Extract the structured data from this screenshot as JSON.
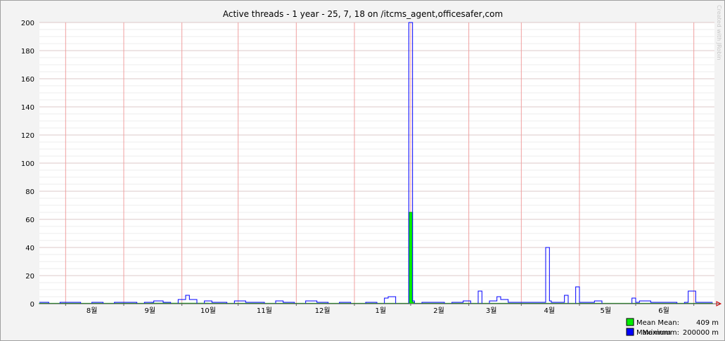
{
  "chart_data": {
    "type": "line",
    "title": "Active threads - 1 year - 25, 7, 18 on /itcms_agent,officesafer,com",
    "watermark": "Created with JRobin",
    "ylim": [
      0,
      200
    ],
    "yticks": [
      "0",
      "20",
      "40",
      "60",
      "80",
      "100",
      "120",
      "140",
      "160",
      "180",
      "200"
    ],
    "xlim": [
      0,
      360
    ],
    "month_labels": [
      {
        "label": "8월",
        "pos": 28
      },
      {
        "label": "9월",
        "pos": 59
      },
      {
        "label": "10월",
        "pos": 90
      },
      {
        "label": "11월",
        "pos": 120
      },
      {
        "label": "12월",
        "pos": 151
      },
      {
        "label": "1월",
        "pos": 182
      },
      {
        "label": "2월",
        "pos": 213
      },
      {
        "label": "3월",
        "pos": 241
      },
      {
        "label": "4월",
        "pos": 272
      },
      {
        "label": "5월",
        "pos": 302
      },
      {
        "label": "6월",
        "pos": 333
      }
    ],
    "month_boundaries": [
      14,
      45,
      76,
      106,
      137,
      168,
      198,
      229,
      257,
      288,
      318,
      349
    ],
    "series": [
      {
        "name": "Mean",
        "color": "#00ee00",
        "stroke": "#009900",
        "x": [
          0,
          30,
          60,
          90,
          120,
          150,
          180,
          196,
          197,
          198,
          199,
          200,
          220,
          240,
          260,
          280,
          300,
          320,
          340,
          359
        ],
        "values": [
          0.3,
          0.3,
          0.4,
          0.3,
          0.3,
          0.3,
          0.3,
          0.3,
          65,
          65,
          1,
          0.3,
          0.3,
          0.3,
          0.3,
          0.3,
          0.3,
          0.3,
          0.3,
          0.3
        ]
      },
      {
        "name": "Maximum",
        "color": "#0000ff",
        "stroke": "#000099",
        "x": [
          0,
          5,
          11,
          17,
          22,
          28,
          34,
          40,
          46,
          52,
          56,
          61,
          66,
          70,
          74,
          78,
          80,
          84,
          88,
          92,
          96,
          100,
          104,
          110,
          116,
          120,
          126,
          130,
          136,
          142,
          148,
          154,
          160,
          166,
          174,
          180,
          184,
          186,
          190,
          196,
          197,
          198,
          199,
          200,
          204,
          210,
          216,
          220,
          226,
          230,
          234,
          236,
          240,
          244,
          246,
          250,
          256,
          262,
          266,
          270,
          271,
          272,
          273,
          274,
          280,
          282,
          283,
          286,
          288,
          290,
          292,
          296,
          300,
          306,
          312,
          316,
          318,
          320,
          326,
          334,
          340,
          344,
          346,
          350,
          356,
          359
        ],
        "values": [
          1,
          0,
          1,
          1,
          0,
          1,
          0,
          1,
          1,
          0,
          1,
          2,
          1,
          0,
          3,
          6,
          3,
          0,
          2,
          1,
          1,
          0,
          2,
          1,
          1,
          0,
          2,
          1,
          0,
          2,
          1,
          0,
          1,
          0,
          1,
          0,
          4,
          5,
          0,
          0,
          200,
          200,
          2,
          0,
          1,
          1,
          0,
          1,
          2,
          0,
          9,
          0,
          2,
          5,
          3,
          1,
          1,
          1,
          1,
          40,
          40,
          2,
          1,
          1,
          6,
          0,
          0,
          12,
          1,
          1,
          1,
          2,
          0,
          0,
          0,
          4,
          1,
          2,
          1,
          1,
          0,
          1,
          9,
          1,
          1,
          1
        ]
      }
    ],
    "legend": [
      {
        "label": "Mean",
        "stat_label": "Mean:",
        "stat_value": "409 m",
        "color": "#00ee00"
      },
      {
        "label": "Maximum",
        "stat_label": "Maximum:",
        "stat_value": "200000 m",
        "color": "#0000ff"
      }
    ]
  }
}
